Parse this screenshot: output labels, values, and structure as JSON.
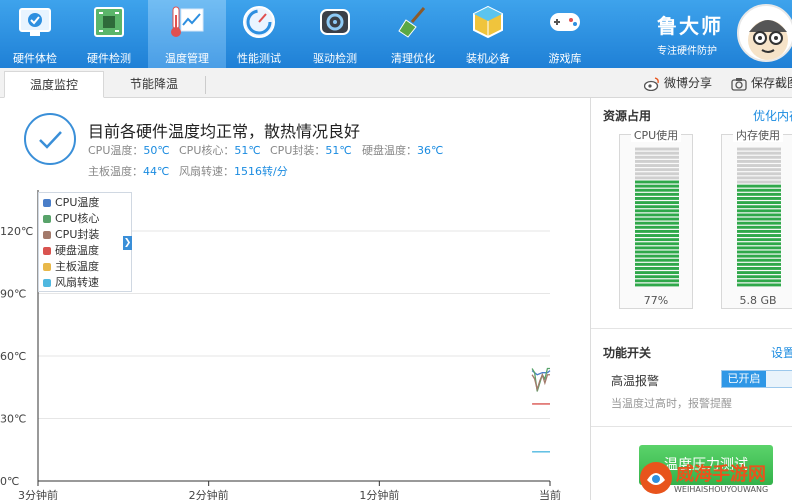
{
  "toolbar": {
    "items": [
      {
        "label": "硬件体检",
        "icon": "monitor-check-icon"
      },
      {
        "label": "硬件检测",
        "icon": "circuit-board-icon"
      },
      {
        "label": "温度管理",
        "icon": "thermometer-chart-icon"
      },
      {
        "label": "性能测试",
        "icon": "speedometer-icon"
      },
      {
        "label": "驱动检测",
        "icon": "gear-icon"
      },
      {
        "label": "清理优化",
        "icon": "broom-icon"
      },
      {
        "label": "装机必备",
        "icon": "cube-icon"
      },
      {
        "label": "游戏库",
        "icon": "gamepad-icon"
      }
    ],
    "active": "温度管理"
  },
  "brand": {
    "title": "鲁大师",
    "subtitle": "专注硬件防护"
  },
  "tabs": [
    {
      "label": "温度监控",
      "active": true
    },
    {
      "label": "节能降温",
      "active": false
    }
  ],
  "actions": {
    "share": "微博分享",
    "screenshot": "保存截图"
  },
  "status": {
    "title": "目前各硬件温度均正常，散热情况良好",
    "metrics": {
      "cpu_temp_label": "CPU温度：",
      "cpu_temp_value": "50℃",
      "cpu_core_label": "CPU核心：",
      "cpu_core_value": "51℃",
      "cpu_pkg_label": "CPU封装：",
      "cpu_pkg_value": "51℃",
      "disk_label": "硬盘温度：",
      "disk_value": "36℃",
      "board_label": "主板温度：",
      "board_value": "44℃",
      "fan_label": "风扇转速：",
      "fan_value": "1516转/分"
    }
  },
  "chart_data": {
    "type": "line",
    "y_ticks": [
      "120℃",
      "90℃",
      "60℃",
      "30℃",
      "0℃"
    ],
    "ylim": [
      0,
      120
    ],
    "x_ticks": [
      "3分钟前",
      "2分钟前",
      "1分钟前",
      "当前"
    ],
    "legend": [
      "CPU温度",
      "CPU核心",
      "CPU封装",
      "硬盘温度",
      "主板温度",
      "风扇转速"
    ],
    "colors": [
      "#4a7ec9",
      "#58a36a",
      "#a37a6b",
      "#d9534f",
      "#e8b84a",
      "#4fb8e0"
    ],
    "series": [
      {
        "name": "CPU温度",
        "x": [
          0.965,
          0.975,
          0.985,
          0.995,
          1.0
        ],
        "values": [
          53,
          51,
          52,
          52,
          53
        ]
      },
      {
        "name": "CPU核心",
        "x": [
          0.965,
          0.97,
          0.975,
          0.98,
          0.985,
          0.99,
          0.995,
          1.0
        ],
        "values": [
          54,
          52,
          43,
          47,
          51,
          49,
          54,
          54
        ]
      },
      {
        "name": "CPU封装",
        "x": [
          0.965,
          0.97,
          0.975,
          0.98,
          0.985,
          0.99,
          0.995,
          1.0
        ],
        "values": [
          51,
          49,
          44,
          48,
          51,
          47,
          51,
          51
        ]
      },
      {
        "name": "硬盘温度",
        "x": [
          0.965,
          1.0
        ],
        "values": [
          37,
          37
        ]
      },
      {
        "name": "风扇转速",
        "x": [
          0.965,
          1.0
        ],
        "values": [
          14,
          14
        ]
      }
    ]
  },
  "resources": {
    "title": "资源占用",
    "optimize_link": "优化内存",
    "cpu": {
      "label": "CPU使用",
      "value_text": "77%",
      "percent": 77
    },
    "memory": {
      "label": "内存使用",
      "value_text": "5.8 GB",
      "percent": 73
    }
  },
  "features": {
    "title": "功能开关",
    "settings_link": "设置",
    "alarm_label": "高温报警",
    "alarm_state": "已开启",
    "hint": "当温度过高时，报警提醒",
    "test_button": "温度压力测试"
  },
  "watermark": {
    "title": "威海手游网",
    "subtitle": "WEIHAISHOUYOUWANG"
  }
}
